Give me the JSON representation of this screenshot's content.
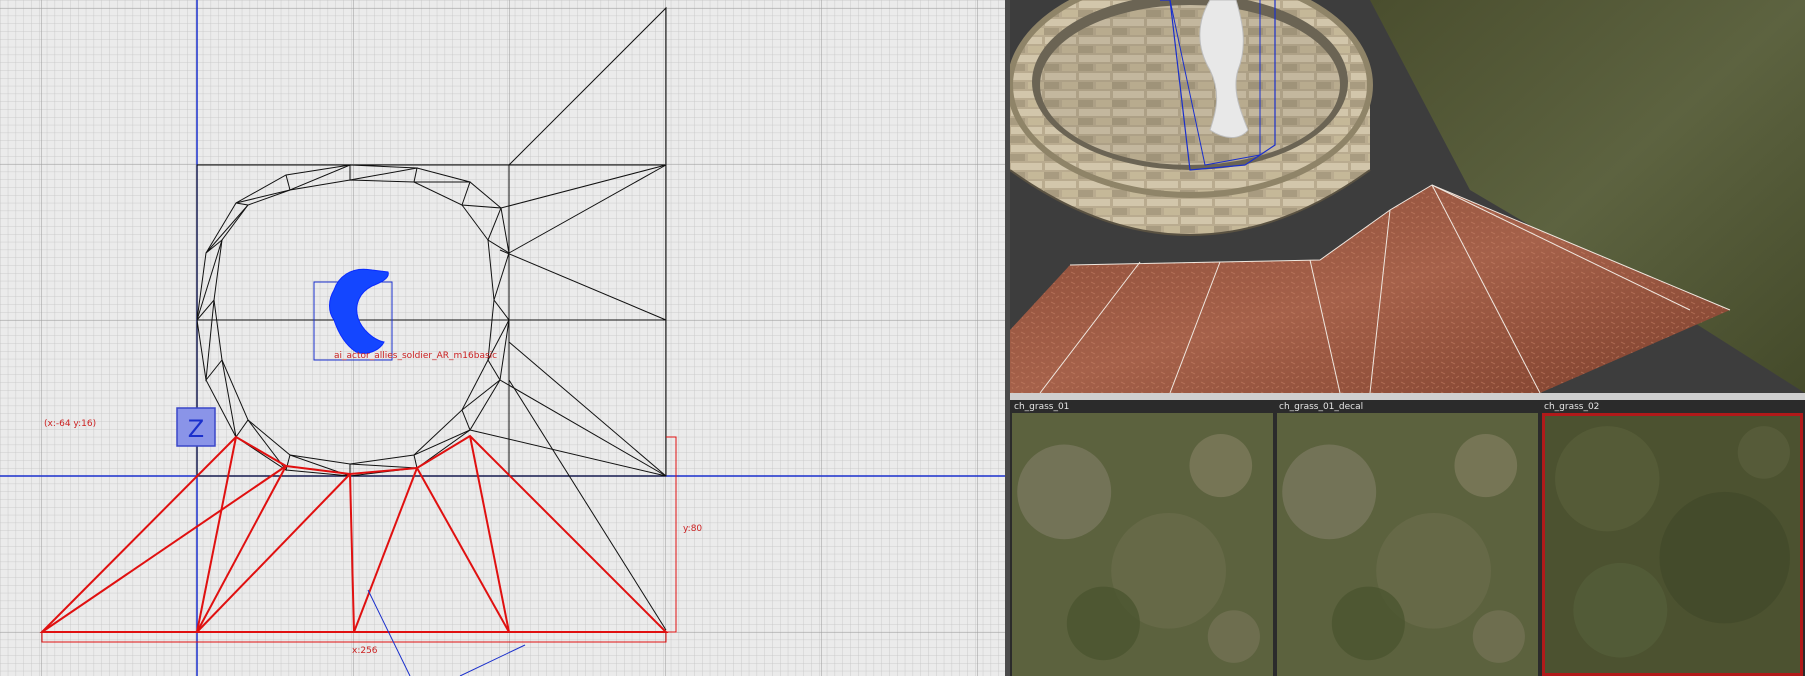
{
  "grid_view": {
    "coord_readout": "(x:-64  y:16)",
    "dim_y": "y:80",
    "dim_x": "x:256",
    "entity_label": "ai_actor_allies_soldier_AR_m16basic",
    "axis_letter": "Z"
  },
  "texture_browser": {
    "textures": [
      {
        "name": "ch_grass_01"
      },
      {
        "name": "ch_grass_01_decal"
      },
      {
        "name": "ch_grass_02"
      }
    ]
  },
  "colors": {
    "selection": "#e01010",
    "axis": "#1a2fcc",
    "grid_bg": "#ebebeb",
    "selected_tile_border": "#b11a1a"
  }
}
